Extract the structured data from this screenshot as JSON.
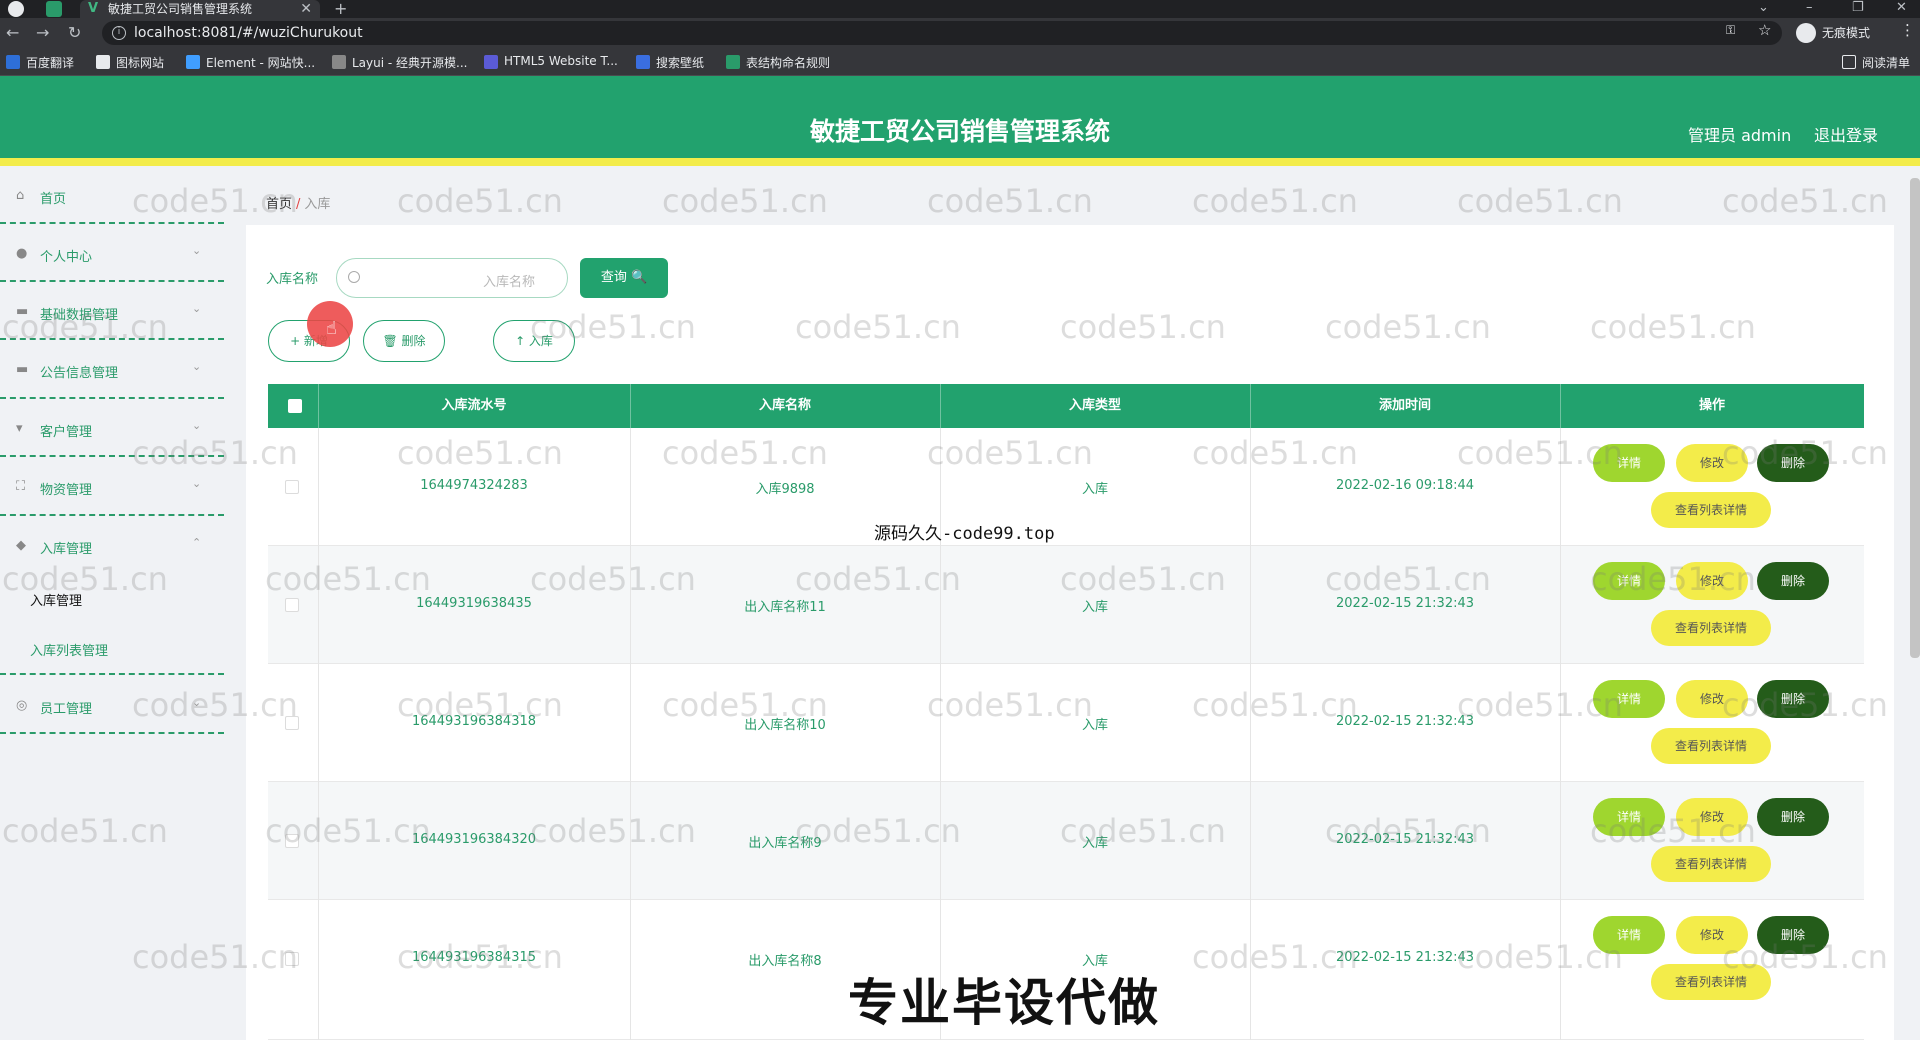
{
  "browser": {
    "tab_title": "敏捷工贸公司销售管理系统",
    "url": "localhost:8081/#/wuziChurukout",
    "incognito_label": "无痕模式",
    "reading_list": "阅读清单",
    "bookmarks": [
      "百度翻译",
      "图标网站",
      "Element - 网站快...",
      "Layui - 经典开源模...",
      "HTML5 Website T...",
      "搜索壁纸",
      "表结构命名规则"
    ]
  },
  "header": {
    "title": "敏捷工贸公司销售管理系统",
    "admin": "管理员 admin",
    "logout": "退出登录"
  },
  "sidebar": {
    "items": [
      {
        "label": "首页",
        "icon": "home-icon"
      },
      {
        "label": "个人中心",
        "icon": "user-icon"
      },
      {
        "label": "基础数据管理",
        "icon": "data-icon"
      },
      {
        "label": "公告信息管理",
        "icon": "notice-icon"
      },
      {
        "label": "客户管理",
        "icon": "customer-icon"
      },
      {
        "label": "物资管理",
        "icon": "goods-icon"
      },
      {
        "label": "入库管理",
        "icon": "warehouse-icon"
      },
      {
        "label": "员工管理",
        "icon": "staff-icon"
      }
    ],
    "sub_items": [
      "入库管理",
      "入库列表管理"
    ]
  },
  "breadcrumb": {
    "home": "首页",
    "sep": "/",
    "current": "入库"
  },
  "search": {
    "label": "入库名称",
    "placeholder": "入库名称",
    "query_button": "查询 🔍"
  },
  "toolbar": {
    "add": "+ 新增",
    "delete": "🗑 删除",
    "inbound": "↑ 入库"
  },
  "table": {
    "columns": [
      "入库流水号",
      "入库名称",
      "入库类型",
      "添加时间",
      "操作"
    ],
    "rows": [
      {
        "serial": "1644974324283",
        "name": "入库9898",
        "type": "入库",
        "time": "2022-02-16 09:18:44"
      },
      {
        "serial": "16449319638435",
        "name": "出入库名称11",
        "type": "入库",
        "time": "2022-02-15 21:32:43"
      },
      {
        "serial": "164493196384318",
        "name": "出入库名称10",
        "type": "入库",
        "time": "2022-02-15 21:32:43"
      },
      {
        "serial": "164493196384320",
        "name": "出入库名称9",
        "type": "入库",
        "time": "2022-02-15 21:32:43"
      },
      {
        "serial": "164493196384315",
        "name": "出入库名称8",
        "type": "入库",
        "time": "2022-02-15 21:32:43"
      }
    ],
    "actions": {
      "detail": "详情",
      "edit": "修改",
      "delete": "删除",
      "list_detail": "查看列表详情"
    }
  },
  "overlays": {
    "watermark": "code51.cn",
    "top_text": "源码久久-code99.top",
    "bottom_text": "专业毕设代做"
  },
  "colors": {
    "primary": "#22a26e",
    "accent_yellow": "#f3ec4a",
    "lime": "#9fd62f",
    "dark_green": "#245c1a"
  }
}
